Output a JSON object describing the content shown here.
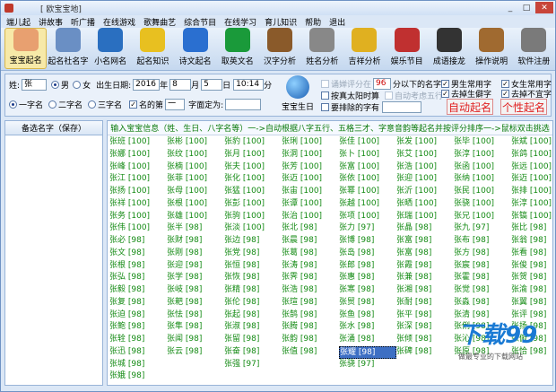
{
  "window": {
    "title": "[ 欧宝宝地]"
  },
  "window_buttons": [
    "_",
    "□",
    "✕"
  ],
  "menu": [
    "端儿起",
    "讲故事",
    "听广播",
    "在线游戏",
    "歌舞曲艺",
    "综合节目",
    "在线学习",
    "育儿知识",
    "帮助",
    "退出"
  ],
  "toolbar": [
    {
      "label": "宝宝起名",
      "icon": "baby-face-icon",
      "color": "#e8a070",
      "selected": true
    },
    {
      "label": "起名社名字",
      "icon": "film-icon",
      "color": "#6a8fc4",
      "selected": false
    },
    {
      "label": "小名网名",
      "icon": "book-icon",
      "color": "#2a6fc0",
      "selected": false
    },
    {
      "label": "起名知识",
      "icon": "lightbulb-icon",
      "color": "#e8c020",
      "selected": false
    },
    {
      "label": "诗文起名",
      "icon": "globe-icon",
      "color": "#2a6fd0",
      "selected": false
    },
    {
      "label": "取英文名",
      "icon": "green-book-icon",
      "color": "#1a9a3a",
      "selected": false
    },
    {
      "label": "汉字分析",
      "icon": "books-icon",
      "color": "#8a5a2a",
      "selected": false
    },
    {
      "label": "姓名分析",
      "icon": "tablet-icon",
      "color": "#888888",
      "selected": false
    },
    {
      "label": "吉祥分析",
      "icon": "radiation-icon",
      "color": "#e0b020",
      "selected": false
    },
    {
      "label": "娱乐节目",
      "icon": "tv-icon",
      "color": "#c03030",
      "selected": false
    },
    {
      "label": "成语接龙",
      "icon": "penguin-icon",
      "color": "#333333",
      "selected": false
    },
    {
      "label": "操作说明",
      "icon": "signpost-icon",
      "color": "#a06a30",
      "selected": false
    },
    {
      "label": "软件注册",
      "icon": "keys-icon",
      "color": "#7a7a7a",
      "selected": false
    }
  ],
  "options": {
    "surname_label": "姓:",
    "surname_value": "张",
    "gender_male": "男",
    "gender_female": "女",
    "birth_label": "出生日期:",
    "year": "2016",
    "year_unit": "年",
    "month": "8",
    "month_unit": "月",
    "day": "5",
    "day_unit": "日",
    "time": "10:14",
    "time_unit": "分",
    "one_char": "一字名",
    "two_char": "二字名",
    "three_char": "三字名",
    "name_nth_label": "名的第",
    "name_nth_value": "一",
    "char_pos_label": "字面定为:",
    "baby_birthday": "宝宝生日",
    "score_label": "诵婵评分在",
    "score_value": "96",
    "score_suffix": "分以下的名字",
    "solar_time": "按真太阳时算",
    "auto_five": "自动考虑五行",
    "exclude_label": "要排除的字有",
    "male_common": "男生常用字",
    "female_common": "女生常用字",
    "remove_rare": "去掉生僻字",
    "remove_unsuitable": "去掉不宜字",
    "auto_name_btn": "自动起名",
    "custom_name_btn": "个性起名"
  },
  "left_panel": {
    "header": "备选名字（保存）"
  },
  "list_header": "输入宝宝信息（姓、生日、八字名等）一->自动根据八字五行、五格三才、字意音韵等起名并按评分排序一->鼠标双击挑选",
  "names": [
    "张班 [100]",
    "张娜 [100]",
    "张峰 [100]",
    "张江 [100]",
    "张扬 [100]",
    "张祥 [100]",
    "张务 [100]",
    "张伟 [100]",
    "张必 [98]",
    "张文 [98]",
    "张根 [98]",
    "张弘 [98]",
    "张毅 [98]",
    "张复 [98]",
    "张迫 [98]",
    "张鲍 [98]",
    "张辁 [98]",
    "张迅 [98]",
    "张城 [98]",
    "张娥 [98]",
    "张豹 [100]",
    "张月 [100]",
    "张夫 [100]",
    "张化 [100]",
    "张猛 [100]",
    "张彭 [100]",
    "张驹 [100]",
    "张淡 [100]",
    "张边 [98]",
    "张党 [98]",
    "张恒 [98]",
    "张恢 [98]",
    "张精 [98]",
    "张伦 [98]",
    "张起 [98]",
    "张淑 [98]",
    "张留 [98]",
    "张奋 [98]",
    "张强 [97]",
    "",
    "张佳 [100]",
    "张卜 [100]",
    "张富 [100]",
    "张依 [100]",
    "张幂 [100]",
    "张越 [100]",
    "张项 [100]",
    "张力 [97]",
    "张博 [98]",
    "张岛 [98]",
    "张郎 [98]",
    "张惠 [98]",
    "张寒 [98]",
    "张贸 [98]",
    "张鱼 [98]",
    "张水 [98]",
    "张涌 [98]",
    "张耀 [98]",
    "张骁 [97]",
    "",
    "张毕 [100]",
    "张淳 [100]",
    "张函 [100]",
    "张纳 [100]",
    "张民 [100]",
    "张骁 [100]",
    "张兄 [100]",
    "张九 [97]",
    "张布 [98]",
    "张方 [98]",
    "张宸 [98]",
    "张霍 [98]",
    "张觉 [98]",
    "张淼 [98]",
    "张清 [98]",
    "张俐 [98]",
    "张沁 [98]",
    "张原 [98]",
    "",
    ""
  ],
  "names_more": [
    "张彬 [100]",
    "张纹 [100]",
    "张楠 [100]",
    "张菲 [100]",
    "张母 [100]",
    "张根 [100]",
    "张雄 [100]",
    "张半 [98]",
    "张财 [98]",
    "张刚 [98]",
    "张迎 [98]",
    "张学 [98]",
    "张岐 [98]",
    "张耙 [98]",
    "张怯 [98]",
    "张隼 [98]",
    "张闻 [98]",
    "张云 [98]",
    "",
    "张琍 [100]",
    "张洞 [100]",
    "张芳 [100]",
    "张迈 [100]",
    "张宙 [100]",
    "张谭 [100]",
    "张治 [100]",
    "张北 [98]",
    "张晨 [98]",
    "张葛 [98]",
    "张涛 [98]",
    "张霁 [98]",
    "张浩 [98]",
    "张瑄 [98]",
    "张鹄 [98]",
    "张腾 [98]",
    "张韵 [98]",
    "张值 [98]",
    "",
    "张发 [100]",
    "张艾 [100]",
    "张浩 [100]",
    "张迎 [100]",
    "张沂 [100]",
    "张晒 [100]",
    "张瑞 [100]",
    "张晶 [98]",
    "张富 [98]",
    "张富 [98]",
    "张霞 [98]",
    "张兼 [98]",
    "张湘 [98]",
    "张耐 [98]",
    "张平 [98]",
    "张深 [98]",
    "张倾 [98]",
    "张碑 [98]",
    "",
    "张斌 [100]",
    "张鸽 [100]",
    "张远 [100]",
    "张迈 [100]",
    "张排 [100]",
    "张淳 [100]",
    "张镐 [100]",
    "张比 [98]",
    "张翁 [98]",
    "张看 [98]",
    "张俊 [98]",
    "张贺 [98]",
    "张渝 [98]",
    "张翼 [98]",
    "张评 [98]",
    "张扬 [98]",
    "张俯 [98]",
    "张恰 [98]",
    ""
  ],
  "selected_name": "张耀 [98]",
  "watermark": {
    "brand": "下载99",
    "slogan": "做最专业的下载网站"
  }
}
